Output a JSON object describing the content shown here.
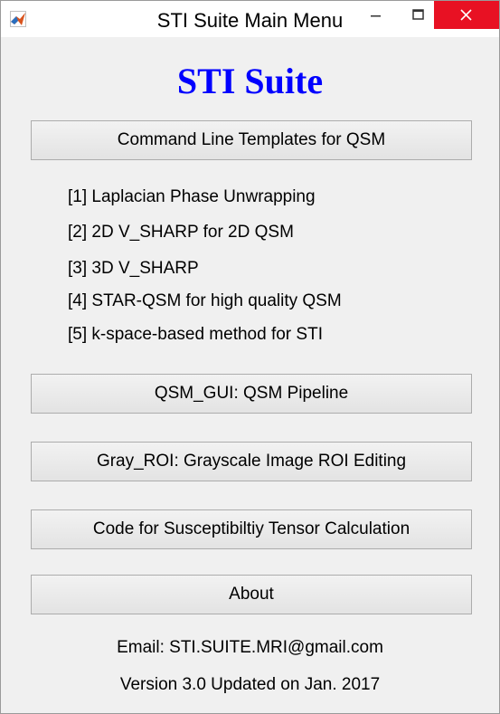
{
  "window": {
    "title": "STI Suite Main Menu"
  },
  "header": {
    "brand": "STI Suite"
  },
  "buttons": {
    "cmd_templates": "Command Line Templates for QSM",
    "qsm_gui": "QSM_GUI: QSM Pipeline",
    "gray_roi": "Gray_ROI: Grayscale Image ROI Editing",
    "tensor_code": "Code for Susceptibiltiy Tensor Calculation",
    "about": "About"
  },
  "templates": [
    "[1] Laplacian Phase Unwrapping",
    "[2] 2D V_SHARP for 2D QSM",
    "[3] 3D V_SHARP",
    "[4] STAR-QSM for high quality QSM",
    "[5] k-space-based method for STI"
  ],
  "footer": {
    "email": "Email: STI.SUITE.MRI@gmail.com",
    "version": "Version 3.0 Updated on Jan. 2017"
  },
  "colors": {
    "brand": "#0000ff",
    "close_button": "#e81123"
  },
  "icons": [
    "matlab-icon",
    "minimize-icon",
    "maximize-icon",
    "close-icon"
  ]
}
